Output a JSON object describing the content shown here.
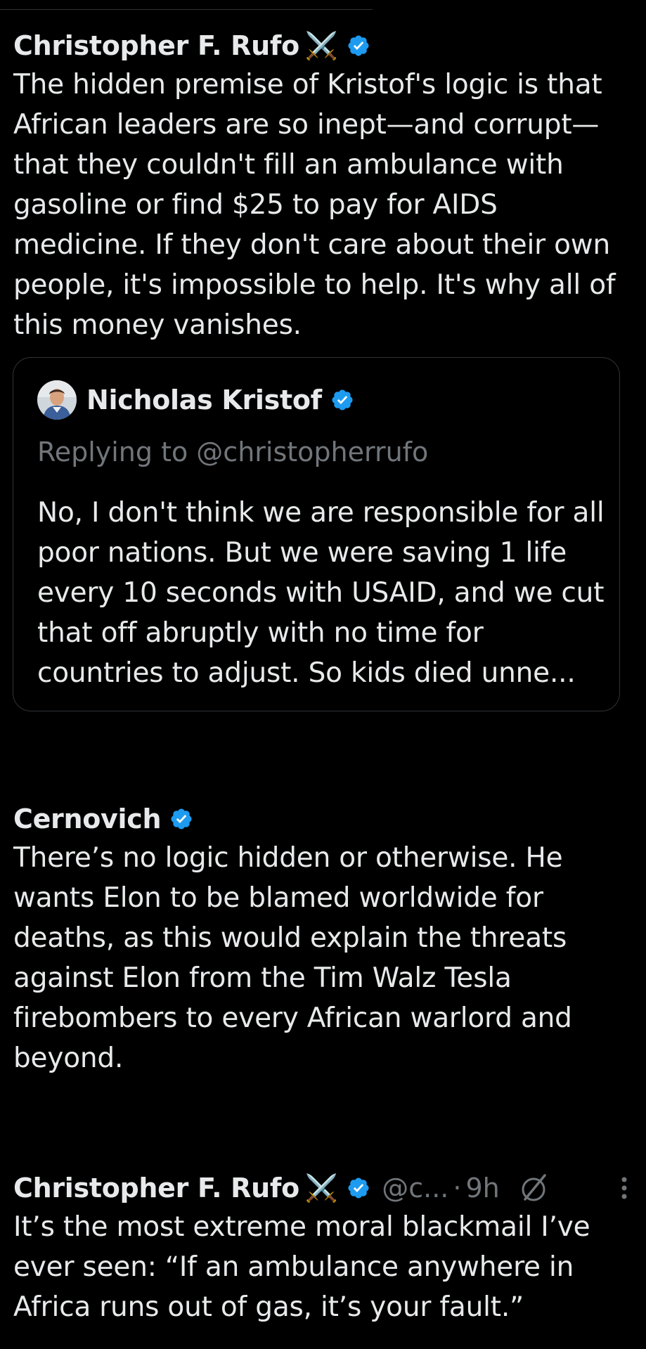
{
  "colors": {
    "background": "#000000",
    "text_primary": "#e7e9ea",
    "text_secondary": "#71767b",
    "verified_blue": "#1d9bf0",
    "border": "#2f3336"
  },
  "posts": [
    {
      "author": "Christopher F. Rufo",
      "emoji": "⚔️",
      "verified": true,
      "body": "The hidden premise of Kristof's logic is that African leaders are so inept—and corrupt—that they couldn't fill an ambulance with gasoline or find $25 to pay for AIDS medicine. If they don't care about their own people, it's impossible to help. It's why all of this money vanishes.",
      "quote": {
        "author": "Nicholas Kristof",
        "verified": true,
        "replying_to": "Replying to @christopherrufo",
        "body": "No, I don't think we are responsible for all poor nations. But we were saving 1 life every 10 seconds with USAID, and we cut that off abruptly with no time for countries to adjust. So kids died unne..."
      }
    },
    {
      "author": "Cernovich",
      "verified": true,
      "body": "There’s no logic hidden or otherwise. He wants Elon to be blamed worldwide for deaths, as this would explain the threats against Elon from the Tim Walz Tesla firebombers to every African warlord and beyond."
    },
    {
      "author": "Christopher F. Rufo",
      "emoji": "⚔️",
      "verified": true,
      "handle": "@c...",
      "separator": "·",
      "time": "9h",
      "icons": [
        "grok-icon",
        "more-icon"
      ],
      "body": "It’s the most extreme moral blackmail I’ve ever seen: “If an ambulance anywhere in Africa runs out of gas, it’s your fault.”"
    }
  ]
}
